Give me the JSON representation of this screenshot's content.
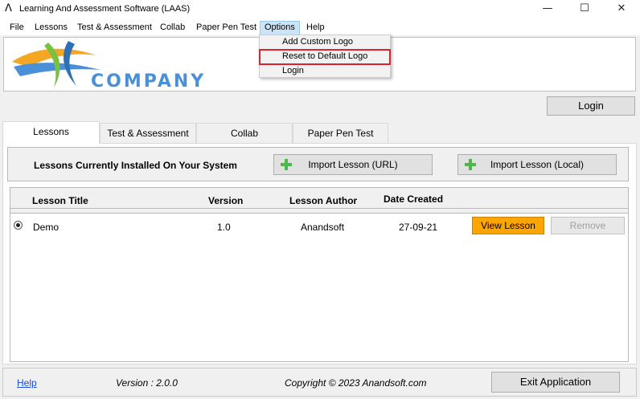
{
  "window": {
    "title": "Learning And Assessment Software (LAAS)",
    "minimize": "—",
    "maximize": "☐",
    "close": "✕"
  },
  "menubar": [
    "File",
    "Lessons",
    "Test & Assessment",
    "Collab",
    "Paper Pen Test",
    "Options",
    "Help"
  ],
  "options_menu": {
    "items": [
      "Add Custom Logo",
      "Reset to Default Logo",
      "Login"
    ],
    "highlighted": "Reset to Default Logo"
  },
  "logo": {
    "text": "COMPANY"
  },
  "login_button": "Login",
  "tabs": [
    "Lessons",
    "Test & Assessment",
    "Collab",
    "Paper Pen Test"
  ],
  "active_tab": "Lessons",
  "lessons": {
    "header": "Lessons Currently Installed On Your System",
    "import_url": "Import Lesson (URL)",
    "import_local": "Import Lesson (Local)",
    "columns": [
      "Lesson Title",
      "Version",
      "Lesson Author",
      "Date Created"
    ],
    "rows": [
      {
        "title": "Demo",
        "version": "1.0",
        "author": "Anandsoft",
        "date": "27-09-21",
        "selected": true
      }
    ],
    "view_button": "View Lesson",
    "remove_button": "Remove"
  },
  "footer": {
    "help": "Help",
    "version": "Version : 2.0.0",
    "copyright": "Copyright © 2023 Anandsoft.com",
    "exit": "Exit Application"
  },
  "colors": {
    "accent_orange": "#ffa500",
    "highlight_red": "#e0202a",
    "link_blue": "#1a4fd6",
    "logo_blue": "#4a90d9"
  }
}
